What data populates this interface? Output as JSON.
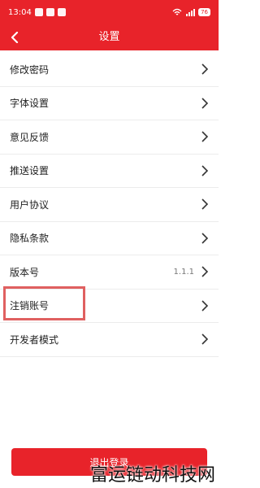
{
  "status_bar": {
    "time": "13:04",
    "battery": "76"
  },
  "header": {
    "title": "设置",
    "back_icon": "chevron-left-icon"
  },
  "settings": {
    "items": [
      {
        "label": "修改密码",
        "value": ""
      },
      {
        "label": "字体设置",
        "value": ""
      },
      {
        "label": "意见反馈",
        "value": ""
      },
      {
        "label": "推送设置",
        "value": ""
      },
      {
        "label": "用户协议",
        "value": ""
      },
      {
        "label": "隐私条款",
        "value": ""
      },
      {
        "label": "版本号",
        "value": "1.1.1"
      },
      {
        "label": "注销账号",
        "value": ""
      },
      {
        "label": "开发者模式",
        "value": ""
      }
    ]
  },
  "logout_label": "退出登录",
  "watermark": "富运链动科技网",
  "colors": {
    "accent": "#e8232a",
    "highlight_box": "#e06060"
  }
}
